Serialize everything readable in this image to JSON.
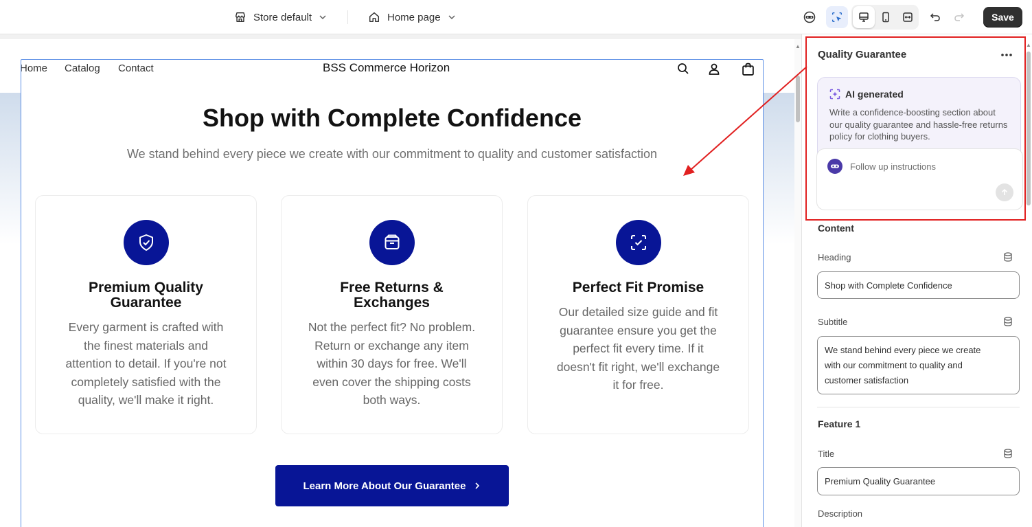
{
  "topbar": {
    "store_selector": "Store default",
    "page_selector": "Home page",
    "save_label": "Save"
  },
  "store": {
    "nav": [
      "Home",
      "Catalog",
      "Contact"
    ],
    "name": "BSS Commerce Horizon"
  },
  "section": {
    "heading": "Shop with Complete Confidence",
    "subtitle": "We stand behind every piece we create with our commitment to quality and customer satisfaction",
    "features": [
      {
        "icon": "shield-check-icon",
        "title_lines": [
          "Premium Quality",
          "Guarantee"
        ],
        "desc_lines": [
          "Every garment is crafted with",
          "the finest materials and",
          "attention to detail. If you're not",
          "completely satisfied with the",
          "quality, we'll make it right."
        ]
      },
      {
        "icon": "box-icon",
        "title_lines": [
          "Free Returns &",
          "Exchanges"
        ],
        "desc_lines": [
          "Not the perfect fit? No problem.",
          "Return or exchange any item",
          "within 30 days for free. We'll",
          "even cover the shipping costs",
          "both ways."
        ]
      },
      {
        "icon": "scan-check-icon",
        "title_lines": [
          "Perfect Fit Promise"
        ],
        "desc_lines": [
          "Our detailed size guide and fit",
          "guarantee ensure you get the",
          "perfect fit every time. If it",
          "doesn't fit right, we'll exchange",
          "it for free."
        ]
      }
    ],
    "cta_label": "Learn More About Our Guarantee"
  },
  "panel": {
    "title": "Quality Guarantee",
    "ai": {
      "label": "AI generated",
      "prompt": "Write a confidence-boosting section about our quality guarantee and hassle-free returns policy for clothing buyers.",
      "followup_placeholder": "Follow up instructions"
    },
    "content_label": "Content",
    "heading_label": "Heading",
    "heading_value": "Shop with Complete Confidence",
    "subtitle_label": "Subtitle",
    "subtitle_lines": [
      "We stand behind every piece we create",
      "with our commitment to quality and",
      "customer satisfaction"
    ],
    "feature1_label": "Feature 1",
    "title_label": "Title",
    "title_value": "Premium Quality Guarantee",
    "description_label": "Description"
  },
  "colors": {
    "brand_navy": "#081596",
    "annotation_red": "#e12020",
    "selection_blue": "#5b8ee6"
  }
}
